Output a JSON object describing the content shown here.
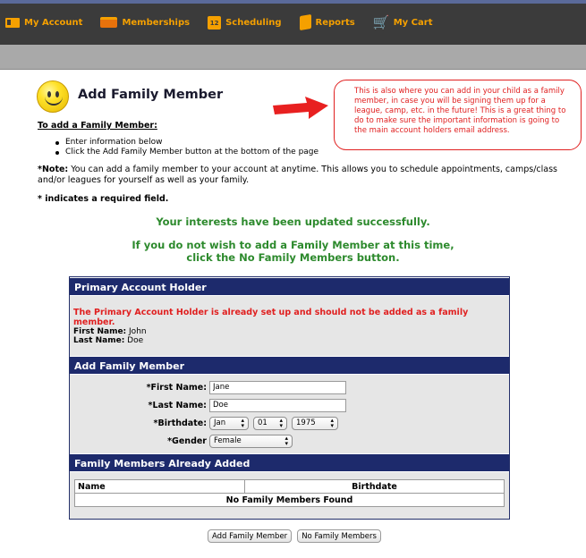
{
  "nav": {
    "items": [
      {
        "label": "My Account",
        "icon": "account-card-icon"
      },
      {
        "label": "Memberships",
        "icon": "membership-card-icon"
      },
      {
        "label": "Scheduling",
        "icon": "calendar-icon",
        "icon_text": "12"
      },
      {
        "label": "Reports",
        "icon": "folder-icon"
      },
      {
        "label": "My Cart",
        "icon": "cart-icon"
      }
    ],
    "accent_color": "#f5a000"
  },
  "page": {
    "title": "Add Family Member",
    "callout": "This is also where you can add in your child as a family member, in case you will be signing them up for a league, camp, etc. in the future! This is a great thing to do to make sure the important information is going to the main account holders email address.",
    "howto_title": "To add a Family Member:",
    "howto_steps": [
      "Enter information below",
      "Click the Add Family Member button at the bottom of the page"
    ],
    "note_label": "*Note:",
    "note_text": " You can add a family member to your account at anytime. This allows you to schedule appointments, camps/class and/or leagues for yourself as well as your family.",
    "required_text": "* indicates a required field.",
    "success_1": "Your interests have been updated successfully.",
    "success_2a": "If you do not wish to add a Family Member at this time,",
    "success_2b": "click the No Family Members button."
  },
  "primary": {
    "header": "Primary Account Holder",
    "warning": "The Primary Account Holder is already set up and should not be added as a family member.",
    "first_label": "First Name:",
    "first_value": "John",
    "last_label": "Last Name:",
    "last_value": "Doe"
  },
  "form": {
    "header": "Add Family Member",
    "first_label": "*First Name:",
    "first_value": "Jane",
    "last_label": "*Last Name:",
    "last_value": "Doe",
    "birth_label": "*Birthdate:",
    "birth_month": "Jan",
    "birth_day": "01",
    "birth_year": "1975",
    "gender_label": "*Gender",
    "gender_value": "Female"
  },
  "added": {
    "header": "Family Members Already Added",
    "col_name": "Name",
    "col_birthdate": "Birthdate",
    "empty": "No Family Members Found"
  },
  "buttons": {
    "add": "Add Family Member",
    "none": "No Family Members"
  },
  "colors": {
    "header_bg": "#1d2a6c",
    "success": "#2d8a2d",
    "warning": "#e02020"
  }
}
